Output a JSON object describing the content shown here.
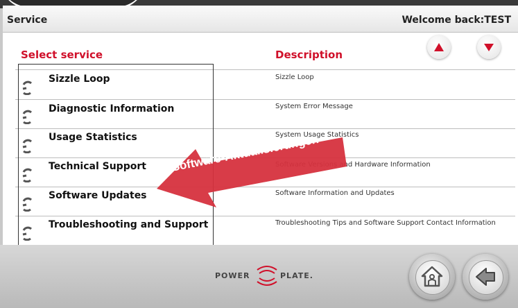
{
  "header": {
    "title": "Service",
    "welcome": "Welcome back:TEST"
  },
  "columns": {
    "service": "Select service",
    "description": "Description"
  },
  "scroll": {
    "up_icon": "triangle-up-icon",
    "down_icon": "triangle-down-icon"
  },
  "services": [
    {
      "label": "Sizzle Loop",
      "description": "Sizzle Loop"
    },
    {
      "label": "Diagnostic Information",
      "description": "System Error Message"
    },
    {
      "label": "Usage Statistics",
      "description": "System Usage Statistics"
    },
    {
      "label": "Technical Support",
      "description": "Software Versions and Hardware Information"
    },
    {
      "label": "Software Updates",
      "description": "Software Information and Updates"
    },
    {
      "label": "Troubleshooting and Support",
      "description": "Troubleshooting Tips and Software Support Contact Information"
    }
  ],
  "footer": {
    "logo_left": "POWER",
    "logo_right": "PLATE."
  },
  "annotation": {
    "text": "Software-Aktualisierungen"
  },
  "colors": {
    "accent": "#d0102a",
    "arrow": "#d6323e"
  }
}
